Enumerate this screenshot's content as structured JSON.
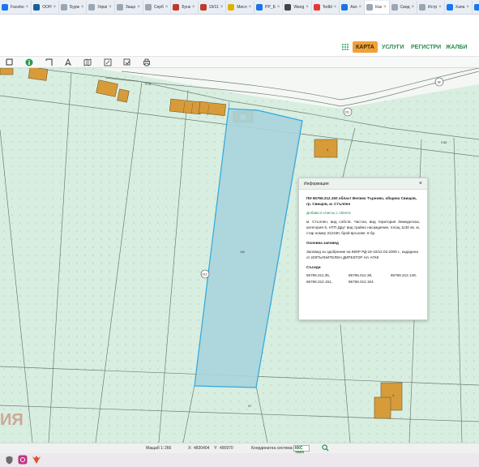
{
  "browser": {
    "tabs": [
      {
        "label": "Facebo",
        "color": "#1877f2"
      },
      {
        "label": "ООН",
        "color": "#1b5e9e"
      },
      {
        "label": "Бурж",
        "color": "#9aa6b2"
      },
      {
        "label": "Украі",
        "color": "#9aa6b2"
      },
      {
        "label": "Защо",
        "color": "#9aa6b2"
      },
      {
        "label": "Серб",
        "color": "#9aa6b2"
      },
      {
        "label": "Бунк",
        "color": "#c0392b"
      },
      {
        "label": "19/11",
        "color": "#c0392b"
      },
      {
        "label": "Мисл",
        "color": "#e0b000"
      },
      {
        "label": "РР_Б",
        "color": "#1a73e8"
      },
      {
        "label": "Wang",
        "color": "#444444"
      },
      {
        "label": "Tedbl",
        "color": "#e53935"
      },
      {
        "label": "Ако",
        "color": "#1a73e8"
      },
      {
        "label": "Как",
        "color": "#9aa6b2"
      },
      {
        "label": "Свид",
        "color": "#9aa6b2"
      },
      {
        "label": "Истр",
        "color": "#9aa6b2"
      },
      {
        "label": "Хапа",
        "color": "#1877f2"
      },
      {
        "label": "Ирл",
        "color": "#1877f2"
      }
    ]
  },
  "header": {
    "nav": [
      "КАРТА",
      "УСЛУГИ",
      "РЕГИСТРИ",
      "ЖАЛБИ"
    ]
  },
  "toolbar": {
    "icons": [
      "select-tool-icon",
      "info-tool-icon",
      "measure-tool-icon",
      "pan-tool-icon",
      "map-layers-icon",
      "edit-tool-icon",
      "crop-tool-icon",
      "print-icon"
    ]
  },
  "map": {
    "labels": {
      "road_label_top": "С70",
      "road_badge_311": "311",
      "road_badge_38": "38",
      "parcel_badge_312": "312",
      "road_label_right": "С45",
      "parcel_number_center": "150",
      "label_4_a": "4",
      "label_4_b": "4",
      "label_37": "37",
      "region_text": "ИЯ"
    }
  },
  "popup": {
    "header_title": "Информация",
    "close": "×",
    "title": "ПИ 65766.312.150 област Велико Търново, община Свищов, гр. Свищов, м. Стълпен",
    "add_link": "Добави в списък с обекти",
    "description": "м. Стълпен, вид собств. Частна, вид територия Земеделска, категория 6, НТП Друг вид трайно насаждение, площ 1130 кв. м, стар номер 312150, брой връхове: 8 бр.",
    "section_order_title": "Основна заповед",
    "order_text": "Заповед за одобрение на КККР РД-18-10/12.02.2009 г., издадена от ИЗПЪЛНИТЕЛЕН ДИРЕКТОР НА АГКК",
    "section_neighbors_title": "Съседи",
    "neighbors": [
      "65766.311.35,",
      "65766.312.38,",
      "65766.312.149,",
      "65766.312.151,",
      "65766.312.154"
    ]
  },
  "statusbar": {
    "scale_label": "Мащаб 1:",
    "scale_value": "266",
    "x_label": "X:",
    "x_value": "4830404",
    "y_label": "Y:",
    "y_value": "490970",
    "crs_label": "Координатна система:",
    "crs_value": "ККС 2005"
  },
  "colors": {
    "map_background": "#d8eee0",
    "parcel_line": "#6c7f72",
    "road": "#f5f7f4",
    "building": "#d79b3a",
    "selected_fill": "#a9d4dc",
    "selected_stroke": "#31a8de",
    "accent_green": "#2a8a4c",
    "accent_orange": "#f0a13a"
  }
}
